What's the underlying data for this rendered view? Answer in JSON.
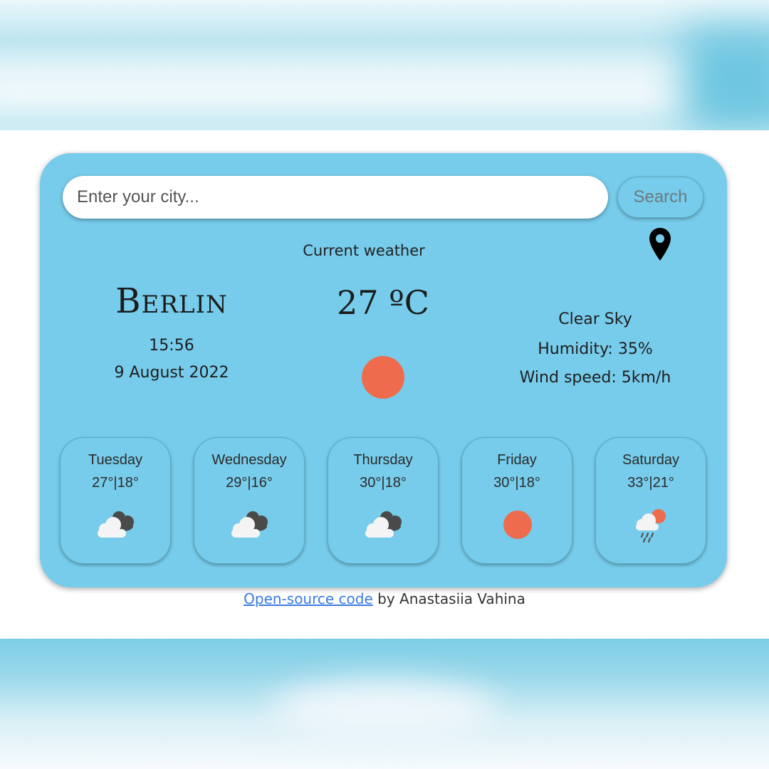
{
  "search": {
    "placeholder": "Enter your city...",
    "button_label": "Search"
  },
  "current": {
    "heading": "Current weather",
    "city": "Berlin",
    "time": "15:56",
    "date": "9 August 2022",
    "temperature": "27 ºC",
    "description": "Clear Sky",
    "humidity": "Humidity: 35%",
    "wind": "Wind speed: 5km/h",
    "icon": "sun-icon"
  },
  "forecast": [
    {
      "day": "Tuesday",
      "temps": "27°|18°",
      "icon": "cloudy-icon"
    },
    {
      "day": "Wednesday",
      "temps": "29°|16°",
      "icon": "cloudy-icon"
    },
    {
      "day": "Thursday",
      "temps": "30°|18°",
      "icon": "cloudy-icon"
    },
    {
      "day": "Friday",
      "temps": "30°|18°",
      "icon": "sun-icon"
    },
    {
      "day": "Saturday",
      "temps": "33°|21°",
      "icon": "rain-sun-icon"
    }
  ],
  "footer": {
    "link_text": "Open-source code",
    "suffix": " by Anastasiia Vahina"
  },
  "colors": {
    "card_bg": "#77cceb",
    "sun": "#ee6c4d",
    "link": "#3b7be0"
  }
}
